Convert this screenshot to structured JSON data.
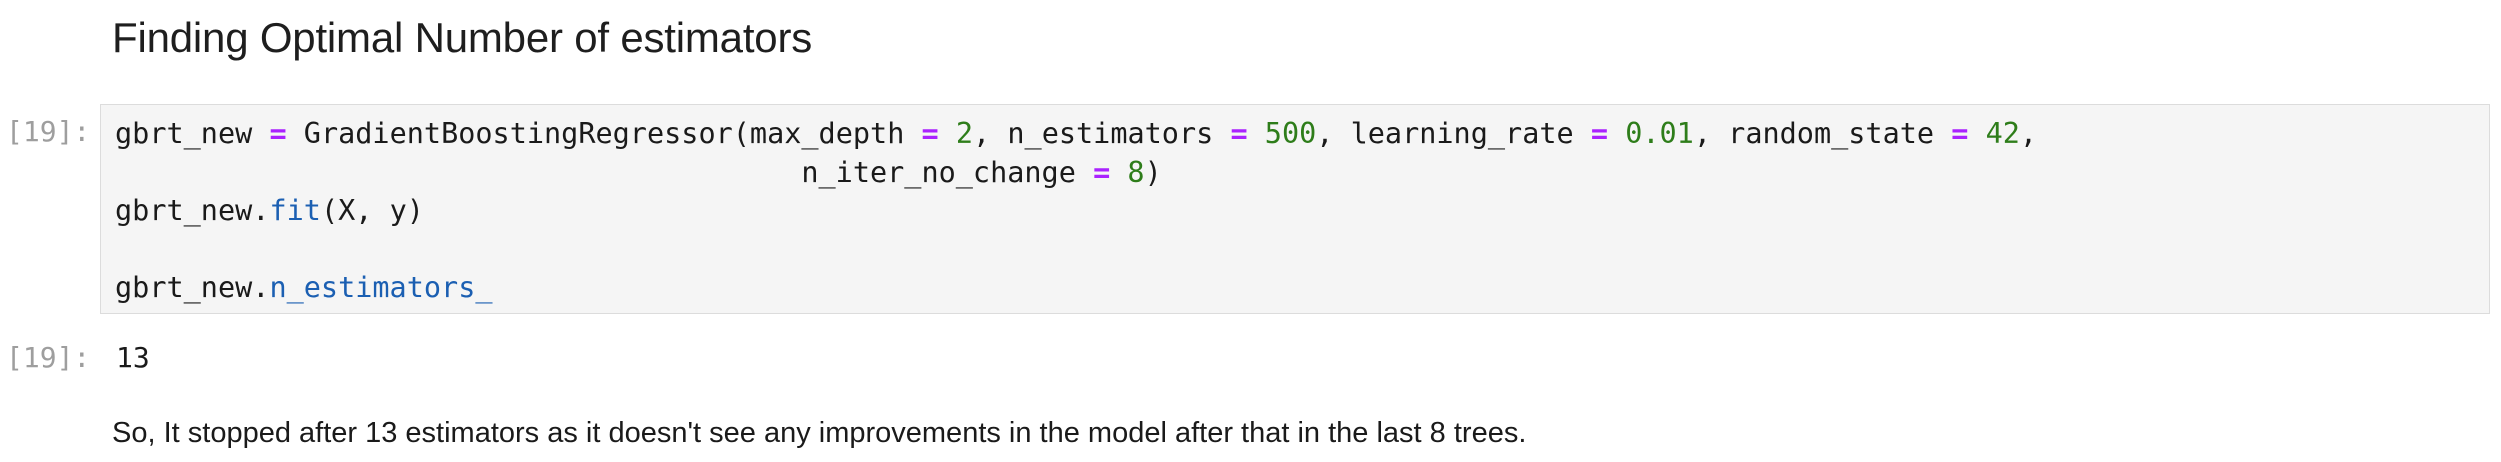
{
  "markdown": {
    "heading": "Finding Optimal Number of estimators",
    "note": "So, It stopped after 13 estimators as it doesn't see any improvements in the model after that in the last 8 trees."
  },
  "cell": {
    "in_prompt": "[19]:",
    "out_prompt": "[19]:",
    "output": "13",
    "code": {
      "l1_var": "gbrt_new",
      "eq": "=",
      "l1_ctor": "GradientBoostingRegressor(",
      "p_max_depth": "max_depth",
      "v_max_depth": "2",
      "p_n_estimators": "n_estimators",
      "v_n_estimators": "500",
      "p_learning_rate": "learning_rate",
      "v_learning_rate": "0.01",
      "p_random_state": "random_state",
      "v_random_state": "42",
      "l2_indent": "                                        ",
      "p_n_iter": "n_iter_no_change",
      "v_n_iter": "8",
      "close_paren": ")",
      "obj": "gbrt_new",
      "dot": ".",
      "fit": "fit",
      "fit_args": "(X, y)",
      "n_estimators_attr": "n_estimators_"
    }
  }
}
